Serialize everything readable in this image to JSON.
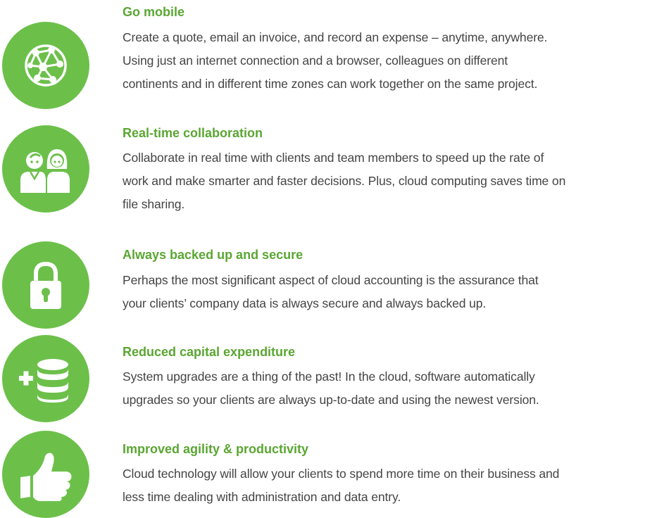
{
  "colors": {
    "accent": "#6cc04a",
    "heading": "#5aa632",
    "text": "#444444"
  },
  "features": [
    {
      "icon": "globe-network-icon",
      "title": "Go mobile",
      "lines": [
        "Create a quote, email an invoice, and record an expense – anytime, anywhere.",
        "Using just an internet connection and a browser, colleagues on different",
        "continents and in different time zones can work together on the same project."
      ]
    },
    {
      "icon": "people-collaboration-icon",
      "title": "Real-time collaboration",
      "lines": [
        "Collaborate in real time with clients and team members to speed up the rate of",
        "work and make smarter and faster decisions.  Plus, cloud computing saves time on",
        "file sharing."
      ]
    },
    {
      "icon": "padlock-icon",
      "title": "Always backed up and secure",
      "lines": [
        "Perhaps the most significant aspect of cloud accounting is the assurance that",
        "your clients’ company data is always secure and always backed up."
      ]
    },
    {
      "icon": "database-plus-icon",
      "title": "Reduced capital expenditure",
      "lines": [
        "System upgrades are a thing of the past! In the cloud, software automatically",
        "upgrades so your clients are always up-to-date and using the newest version."
      ]
    },
    {
      "icon": "thumbs-up-icon",
      "title": "Improved agility & productivity",
      "lines": [
        "Cloud technology will allow your clients to spend more time on their business and",
        "less time dealing with administration and data entry."
      ]
    }
  ]
}
